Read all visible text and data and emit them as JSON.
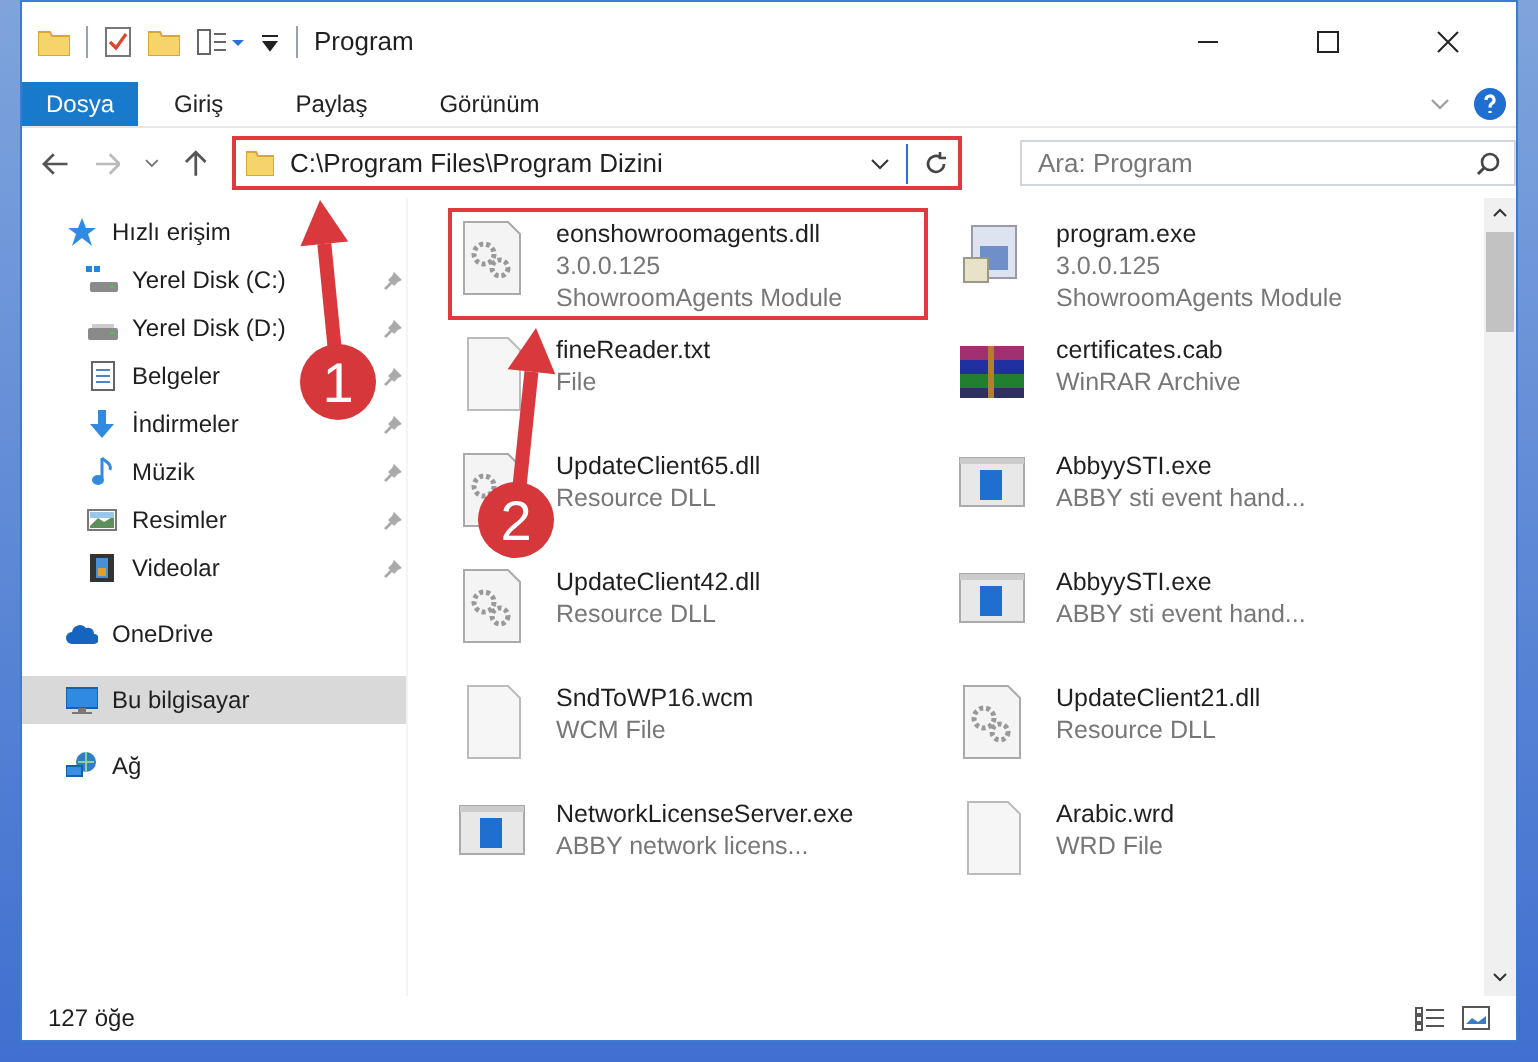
{
  "window": {
    "title": "Program"
  },
  "ribbon_tabs": [
    {
      "label": "Dosya",
      "selected": true
    },
    {
      "label": "Giriş",
      "selected": false
    },
    {
      "label": "Paylaş",
      "selected": false
    },
    {
      "label": "Görünüm",
      "selected": false
    }
  ],
  "address_bar": {
    "value": "C:\\Program Files\\Program Dizini",
    "highlighted": true
  },
  "search": {
    "placeholder": "Ara: Program"
  },
  "sidebar": {
    "items": [
      {
        "label": "Hızlı erişim",
        "kind": "star",
        "selected": false,
        "children": [
          {
            "label": "Yerel Disk (C:)",
            "kind": "sysdisk",
            "pinned": true,
            "selected": false
          },
          {
            "label": "Yerel Disk (D:)",
            "kind": "disk",
            "pinned": true,
            "selected": false
          },
          {
            "label": "Belgeler",
            "kind": "docs",
            "pinned": true,
            "selected": false
          },
          {
            "label": "İndirmeler",
            "kind": "download",
            "pinned": true,
            "selected": false
          },
          {
            "label": "Müzik",
            "kind": "music",
            "pinned": true,
            "selected": false
          },
          {
            "label": "Resimler",
            "kind": "pictures",
            "pinned": true,
            "selected": false
          },
          {
            "label": "Videolar",
            "kind": "videos",
            "pinned": true,
            "selected": false
          }
        ]
      },
      {
        "label": "OneDrive",
        "kind": "cloud",
        "selected": false
      },
      {
        "label": "Bu bilgisayar",
        "kind": "pc",
        "selected": true
      },
      {
        "label": "Ağ",
        "kind": "network",
        "selected": false
      }
    ]
  },
  "files": [
    {
      "name": "eonshowroomagents.dll",
      "lines": [
        "3.0.0.125",
        "ShowroomAgents Module"
      ],
      "kind": "dll",
      "highlighted": true
    },
    {
      "name": "program.exe",
      "lines": [
        "3.0.0.125",
        "ShowroomAgents Module"
      ],
      "kind": "program",
      "highlighted": false
    },
    {
      "name": "fineReader.txt",
      "lines": [
        "File"
      ],
      "kind": "blank",
      "highlighted": false
    },
    {
      "name": "certificates.cab",
      "lines": [
        "WinRAR Archive"
      ],
      "kind": "archive",
      "highlighted": false
    },
    {
      "name": "UpdateClient65.dll",
      "lines": [
        "Resource DLL"
      ],
      "kind": "dll",
      "highlighted": false
    },
    {
      "name": "AbbyySTI.exe",
      "lines": [
        "ABBY sti event hand..."
      ],
      "kind": "window",
      "highlighted": false
    },
    {
      "name": "UpdateClient42.dll",
      "lines": [
        "Resource DLL"
      ],
      "kind": "dll",
      "highlighted": false
    },
    {
      "name": "AbbyySTI.exe",
      "lines": [
        "ABBY sti event hand..."
      ],
      "kind": "window",
      "highlighted": false
    },
    {
      "name": "SndToWP16.wcm",
      "lines": [
        "WCM File"
      ],
      "kind": "blank",
      "highlighted": false
    },
    {
      "name": "UpdateClient21.dll",
      "lines": [
        "Resource DLL"
      ],
      "kind": "dll",
      "highlighted": false
    },
    {
      "name": "NetworkLicenseServer.exe",
      "lines": [
        "ABBY network licens..."
      ],
      "kind": "window",
      "highlighted": false
    },
    {
      "name": "Arabic.wrd",
      "lines": [
        "WRD File"
      ],
      "kind": "blank",
      "highlighted": false
    }
  ],
  "status_bar": {
    "count": "127 öğe"
  },
  "annotations": [
    {
      "label": "1"
    },
    {
      "label": "2"
    }
  ]
}
